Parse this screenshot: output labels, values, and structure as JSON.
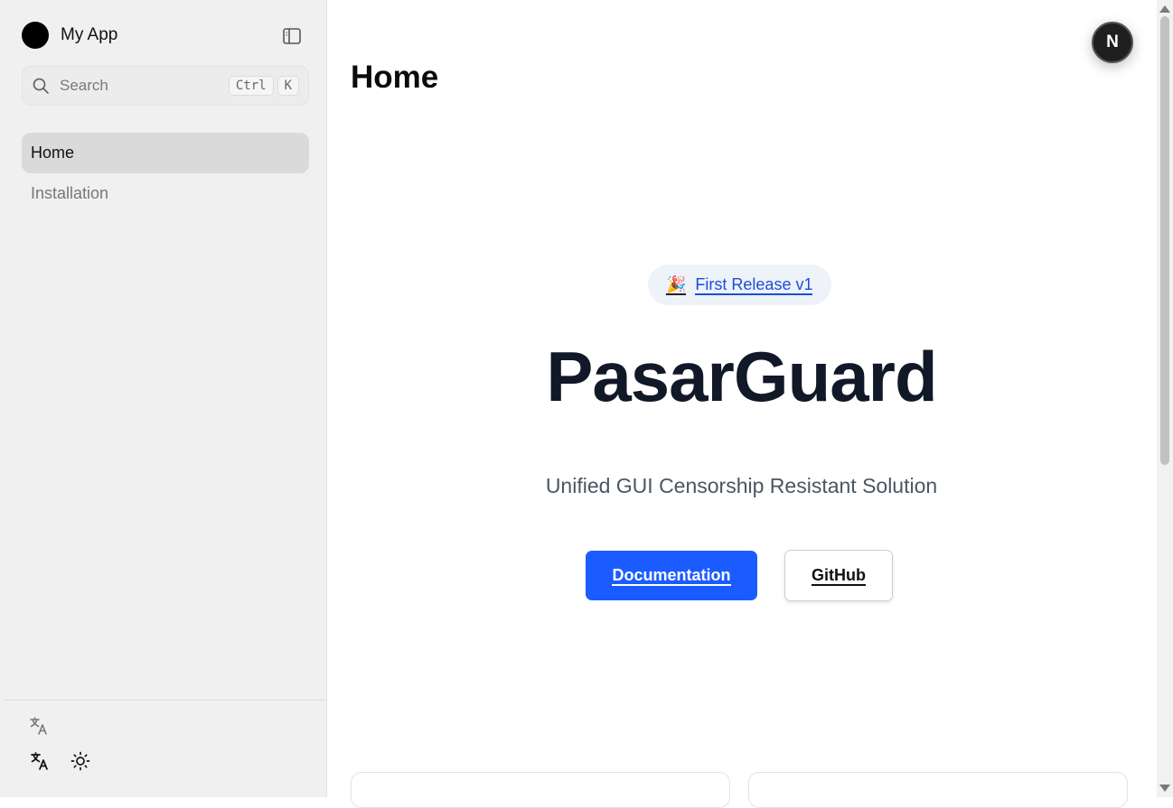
{
  "sidebar": {
    "brand_name": "My App",
    "search": {
      "placeholder": "Search",
      "shortcut_keys": [
        "Ctrl",
        "K"
      ]
    },
    "items": [
      {
        "label": "Home",
        "active": true
      },
      {
        "label": "Installation",
        "active": false
      }
    ],
    "footer_icons": [
      "translate-icon",
      "translate-icon",
      "sun-icon"
    ]
  },
  "main": {
    "page_title": "Home",
    "avatar_letter": "N",
    "release_badge": {
      "emoji": "🎉",
      "label": "First Release v1"
    },
    "hero_title": "PasarGuard",
    "hero_subtitle": "Unified GUI Censorship Resistant Solution",
    "buttons": {
      "docs": "Documentation",
      "github": "GitHub"
    }
  },
  "colors": {
    "accent": "#1a5cff",
    "link": "#1b4fd8",
    "sidebar_bg": "#f0f0f0",
    "active_item_bg": "#dadada"
  }
}
